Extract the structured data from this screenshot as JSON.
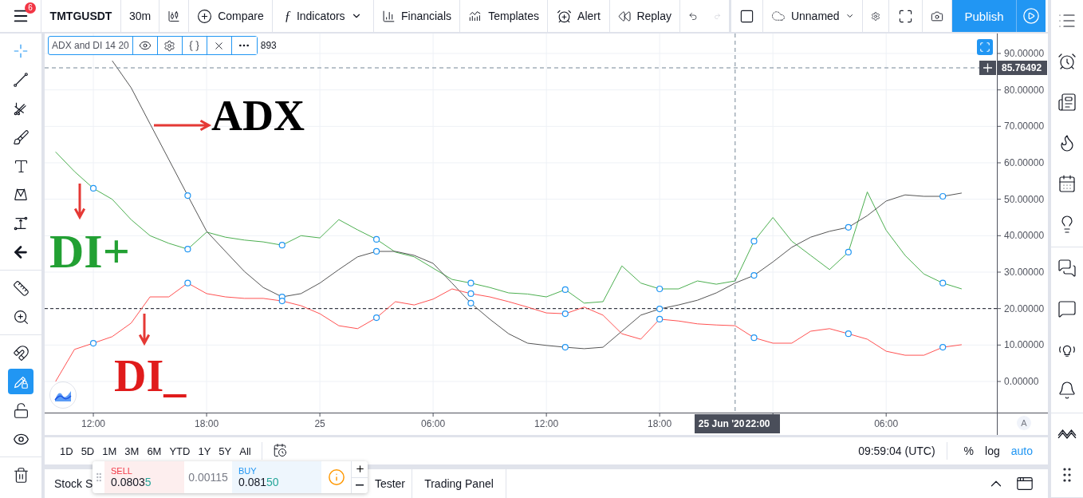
{
  "top_bar": {
    "menu_badge": "6",
    "symbol": "TMTGUSDT",
    "interval": "30m",
    "compare": "Compare",
    "indicators_icon": "ƒ",
    "indicators": "Indicators",
    "financials": "Financials",
    "templates": "Templates",
    "alert": "Alert",
    "replay": "Replay",
    "redo": {
      "disabled": true
    },
    "layout": "Unnamed",
    "publish": "Publish"
  },
  "left_toolbar": {
    "groups": [
      [
        {
          "kind": "crosshair",
          "selected": true
        },
        {
          "kind": "line",
          "selected": false
        },
        {
          "kind": "pitchfork",
          "selected": false
        },
        {
          "kind": "brush",
          "selected": false
        },
        {
          "kind": "text",
          "selected": false
        },
        {
          "kind": "pattern",
          "selected": false
        },
        {
          "kind": "projection",
          "selected": false
        },
        {
          "kind": "back",
          "selected": false
        }
      ],
      [
        {
          "kind": "ruler",
          "selected": false
        },
        {
          "kind": "zoom",
          "selected": false
        }
      ],
      [
        {
          "kind": "magnet",
          "on": false
        },
        {
          "kind": "lockdraw",
          "on": true
        },
        {
          "kind": "unlock",
          "on": false
        },
        {
          "kind": "eye",
          "on": false
        }
      ],
      [
        {
          "kind": "trash",
          "on": false
        }
      ]
    ]
  },
  "chart": {
    "legend": {
      "title": "ADX and DI 14 20",
      "value": "893"
    },
    "chart_data": {
      "type": "line",
      "grid": true,
      "series": [
        {
          "name": "DI+",
          "color": "#4caf50",
          "values": [
            63,
            57.6,
            53,
            50,
            44.4,
            40,
            37.9,
            36.3,
            41,
            39.6,
            38.8,
            38.3,
            37.4,
            40,
            39.4,
            44.4,
            41.6,
            39,
            35.5,
            34.2,
            31.1,
            28,
            27,
            25.8,
            24.3,
            24,
            23.2,
            25.2,
            21.5,
            21.9,
            31.7,
            27,
            25.4,
            25.4,
            27.6,
            26.7,
            27.6,
            38.5,
            45,
            38.5,
            34.6,
            30.7,
            35.5,
            52,
            41.5,
            34.6,
            29.5,
            27,
            25.4
          ]
        },
        {
          "name": "ADX",
          "color": "#555555",
          "values": [
            null,
            null,
            null,
            88,
            80.6,
            70.7,
            60.9,
            51,
            41.2,
            35.7,
            30.2,
            25.8,
            23.2,
            24.1,
            27,
            30.7,
            34.2,
            35.7,
            35.7,
            34.6,
            32.4,
            27,
            21.5,
            17.1,
            13.1,
            10.5,
            9.9,
            9.4,
            9,
            9.4,
            13.8,
            18.2,
            19.9,
            21,
            22.3,
            24.3,
            27,
            29.1,
            32.8,
            36.8,
            39.6,
            41.2,
            42.3,
            45.5,
            49.5,
            51.2,
            50.8,
            50.8,
            51.7
          ]
        },
        {
          "name": "DI_",
          "color": "#ff5252",
          "values": [
            0,
            8.8,
            10.5,
            12.3,
            16,
            23.2,
            23.2,
            27,
            24.1,
            23.2,
            22.8,
            22.8,
            22.1,
            20.8,
            18.6,
            15.3,
            14.5,
            17.5,
            21.9,
            21,
            22.6,
            25.4,
            24.1,
            23.2,
            21.9,
            20.4,
            18.8,
            18.6,
            20.4,
            18.2,
            13.1,
            11.6,
            17.1,
            16.6,
            15.8,
            15.5,
            15.3,
            12,
            10.5,
            10.5,
            13.8,
            14.5,
            13.1,
            11.6,
            8.3,
            7.2,
            7.2,
            9.4,
            10.1
          ]
        }
      ],
      "ylim": [
        -8.54,
        95.47
      ],
      "yticks": [
        {
          "value": 0,
          "label": "0.00000"
        },
        {
          "value": 10,
          "label": "10.00000"
        },
        {
          "value": 20,
          "label": "20.00000"
        },
        {
          "value": 30,
          "label": "30.00000"
        },
        {
          "value": 40,
          "label": "40.00000"
        },
        {
          "value": 50,
          "label": "50.00000"
        },
        {
          "value": 60,
          "label": "60.00000"
        },
        {
          "value": 70,
          "label": "70.00000"
        },
        {
          "value": 80,
          "label": "80.00000"
        },
        {
          "value": 90,
          "label": "90.00000"
        }
      ],
      "ref_lines": [
        {
          "axis": "y",
          "value": 20
        }
      ]
    },
    "time_axis": [
      "12:00",
      "18:00",
      "25",
      "06:00",
      "12:00",
      "18:00",
      "06:00"
    ],
    "crosshair": {
      "price": "85.76492",
      "date": "25 Jun '20",
      "time": "22:00"
    },
    "auto_button": "A"
  },
  "range_bar": {
    "ranges": [
      "1D",
      "5D",
      "1M",
      "3M",
      "6M",
      "YTD",
      "1Y",
      "5Y",
      "All"
    ],
    "clock": "09:59:04 (UTC)",
    "toggles": [
      {
        "label": "%",
        "on": false
      },
      {
        "label": "log",
        "on": false
      },
      {
        "label": "auto",
        "on": true
      }
    ]
  },
  "trade_widget": {
    "sell_label": "SELL",
    "sell_price": "0.0803",
    "sell_tail": "5",
    "spread": "0.00115",
    "buy_label": "BUY",
    "buy_price": "0.081",
    "buy_tail": "50"
  },
  "bottom_panel": {
    "tabs": [
      "Stock S",
      "Tester",
      "Trading Panel"
    ]
  },
  "right_sidebar": {
    "groups": [
      [
        {
          "kind": "watchlist"
        },
        {
          "kind": "alerts"
        },
        {
          "kind": "news"
        },
        {
          "kind": "hotlist"
        },
        {
          "kind": "calendar"
        },
        {
          "kind": "ideas"
        }
      ],
      [
        {
          "kind": "chats"
        },
        {
          "kind": "chat"
        },
        {
          "kind": "streams"
        },
        {
          "kind": "notifications"
        }
      ],
      [
        {
          "kind": "depth"
        },
        {
          "kind": "grid"
        }
      ]
    ]
  }
}
